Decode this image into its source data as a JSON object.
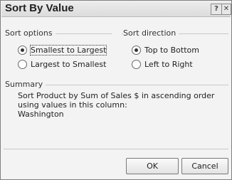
{
  "window": {
    "title": "Sort By Value",
    "help_glyph": "?",
    "close_glyph": "✕"
  },
  "sort_options": {
    "label": "Sort options",
    "items": [
      {
        "label": "Smallest to Largest",
        "checked": true
      },
      {
        "label": "Largest to Smallest",
        "checked": false
      }
    ]
  },
  "sort_direction": {
    "label": "Sort direction",
    "items": [
      {
        "label": "Top to Bottom",
        "checked": true
      },
      {
        "label": "Left to Right",
        "checked": false
      }
    ]
  },
  "summary": {
    "label": "Summary",
    "text": "Sort Product by Sum of Sales $ in ascending order using values in this column:",
    "column": "Washington"
  },
  "buttons": {
    "ok": "OK",
    "cancel": "Cancel"
  }
}
